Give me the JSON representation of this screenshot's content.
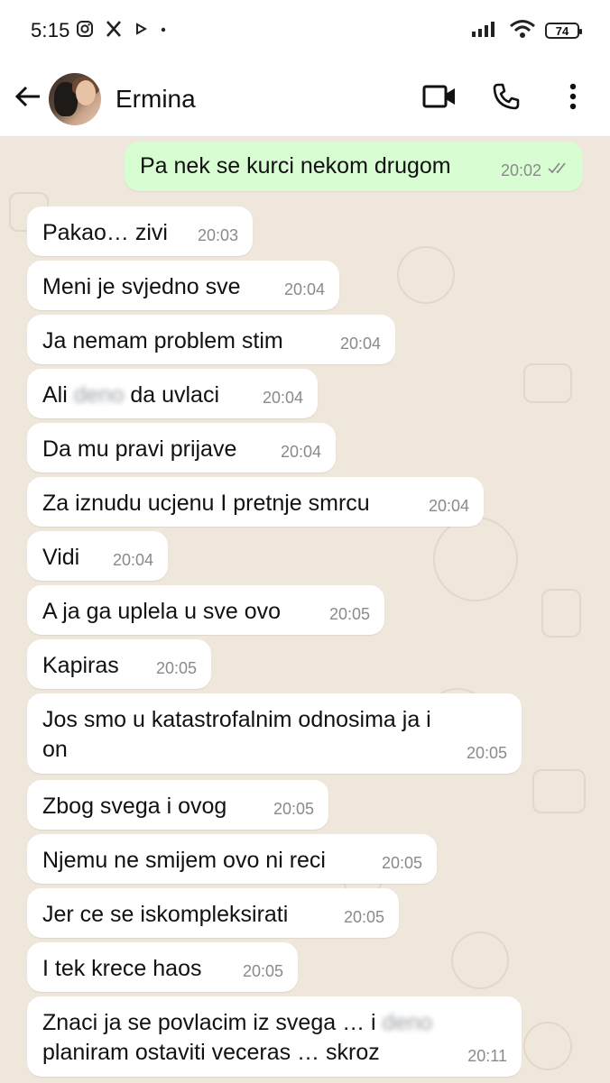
{
  "status_bar": {
    "time": "5:15",
    "battery": "74",
    "icons": [
      "instagram-icon",
      "x-icon",
      "play-icon",
      "dot-icon",
      "signal-icon",
      "wifi-icon",
      "battery-icon"
    ]
  },
  "header": {
    "contact_name": "Ermina",
    "icons": [
      "back-arrow-icon",
      "avatar",
      "video-call-icon",
      "phone-icon",
      "more-vert-icon"
    ]
  },
  "colors": {
    "outgoing_bubble": "#d9fdd3",
    "incoming_bubble": "#ffffff",
    "chat_background": "#efe6dc"
  },
  "messages": [
    {
      "dir": "out",
      "text": "Pa nek se kurci nekom drugom",
      "time": "20:02",
      "status": "read"
    },
    {
      "dir": "in",
      "text": "Pakao… zivi",
      "time": "20:03"
    },
    {
      "dir": "in",
      "text": "Meni je svjedno sve",
      "time": "20:04"
    },
    {
      "dir": "in",
      "text": "Ja nemam problem stim",
      "time": "20:04"
    },
    {
      "dir": "in",
      "text_before": "Ali",
      "blurred": "deno",
      "text_after": "da uvlaci",
      "time": "20:04"
    },
    {
      "dir": "in",
      "text": "Da mu pravi prijave",
      "time": "20:04"
    },
    {
      "dir": "in",
      "text": "Za iznudu ucjenu I pretnje smrcu",
      "time": "20:04"
    },
    {
      "dir": "in",
      "text": "Vidi",
      "time": "20:04"
    },
    {
      "dir": "in",
      "text": "A ja ga uplela u sve ovo",
      "time": "20:05"
    },
    {
      "dir": "in",
      "text": "Kapiras",
      "time": "20:05"
    },
    {
      "dir": "in",
      "text": "Jos smo u katastrofalnim odnosima ja i\non",
      "time": "20:05"
    },
    {
      "dir": "in",
      "text": "Zbog svega i ovog",
      "time": "20:05"
    },
    {
      "dir": "in",
      "text": "Njemu ne smijem ovo ni reci",
      "time": "20:05"
    },
    {
      "dir": "in",
      "text": "Jer ce se iskompleksirati",
      "time": "20:05"
    },
    {
      "dir": "in",
      "text": "I tek krece haos",
      "time": "20:05"
    },
    {
      "dir": "in",
      "text_before": "Znaci ja se povlacim iz svega … i",
      "blurred": "deno",
      "text_after": "planiram ostaviti veceras … skroz",
      "time": "20:11"
    }
  ]
}
